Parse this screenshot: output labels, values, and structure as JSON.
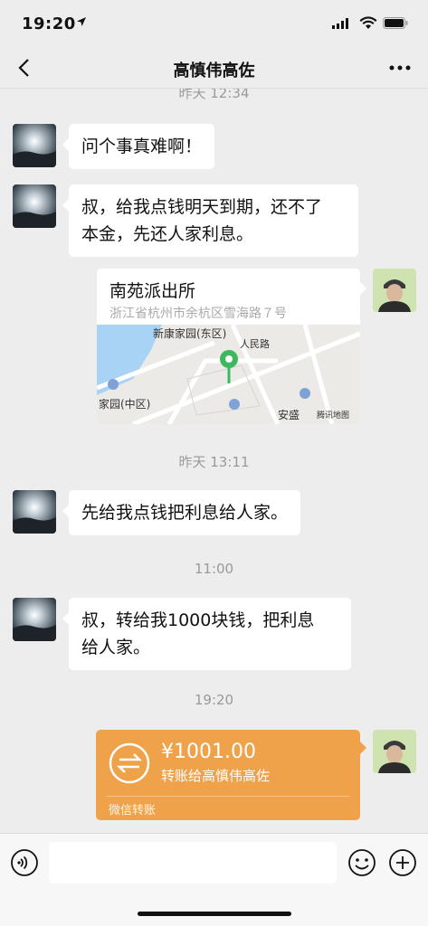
{
  "status_bar": {
    "time": "19:20"
  },
  "nav": {
    "title": "高慎伟高佐"
  },
  "messages": {
    "ts_top": "昨天 12:34",
    "m1": "问个事真难啊！",
    "m2_line1": "叔，给我点钱明天到期，还不了",
    "m2_line2": "本金，先还人家利息。",
    "location": {
      "name": "南苑派出所",
      "address": "浙江省杭州市余杭区雪海路７号",
      "map_labels": {
        "l1": "新康家园(东区)",
        "l2": "人民路",
        "l3": "家园(中区)",
        "l4": "安盛",
        "l5": "腾讯地图"
      }
    },
    "ts2": "昨天 13:11",
    "m3": "先给我点钱把利息给人家。",
    "ts3": "11:00",
    "m4_line1": "叔，转给我1000块钱，把利息",
    "m4_line2": "给人家。",
    "ts4": "19:20",
    "transfer": {
      "amount": "¥1001.00",
      "to": "转账给高慎伟高佐",
      "source": "微信转账"
    }
  },
  "colors": {
    "transfer_orange": "#f0a24b",
    "map_pin": "#3db85f"
  },
  "icons": [
    "back-arrow-icon",
    "more-icon",
    "voice-icon",
    "emoji-icon",
    "plus-icon",
    "transfer-icon",
    "map-pin-icon"
  ]
}
